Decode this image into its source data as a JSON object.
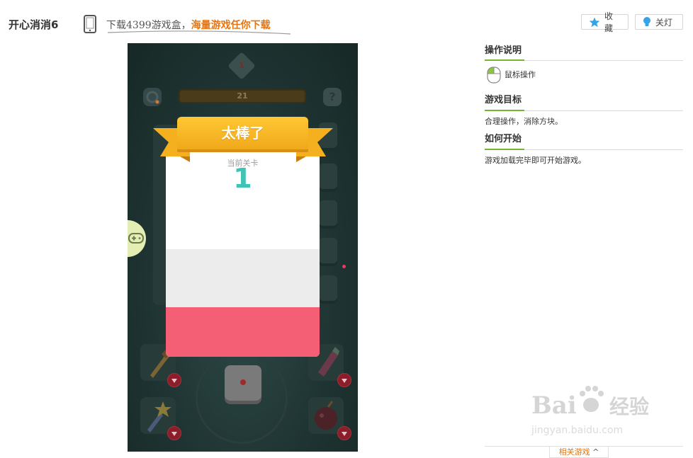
{
  "header": {
    "title": "开心消消6",
    "promo_text": "下载4399游戏盒，",
    "promo_highlight": "海量游戏任你下载",
    "favorite_label": "收藏",
    "lights_label": "关灯"
  },
  "game": {
    "top_level": "1",
    "moves_counter": "21",
    "help_symbol": "?",
    "popup": {
      "title": "太棒了",
      "subtitle": "当前关卡",
      "level": "1"
    },
    "colors": {
      "popup_accent": "#f5b820",
      "level_number": "#3fc3b4",
      "button_pink": "#f45f76"
    }
  },
  "sidebar": {
    "sections": [
      {
        "title": "操作说明",
        "text": "鼠标操作"
      },
      {
        "title": "游戏目标",
        "text": "合理操作，消除方块。"
      },
      {
        "title": "如何开始",
        "text": "游戏加载完毕即可开始游戏。"
      }
    ],
    "related_label": "相关游戏"
  },
  "watermark": {
    "brand": "Bai 经验",
    "url": "jingyan.baidu.com"
  }
}
